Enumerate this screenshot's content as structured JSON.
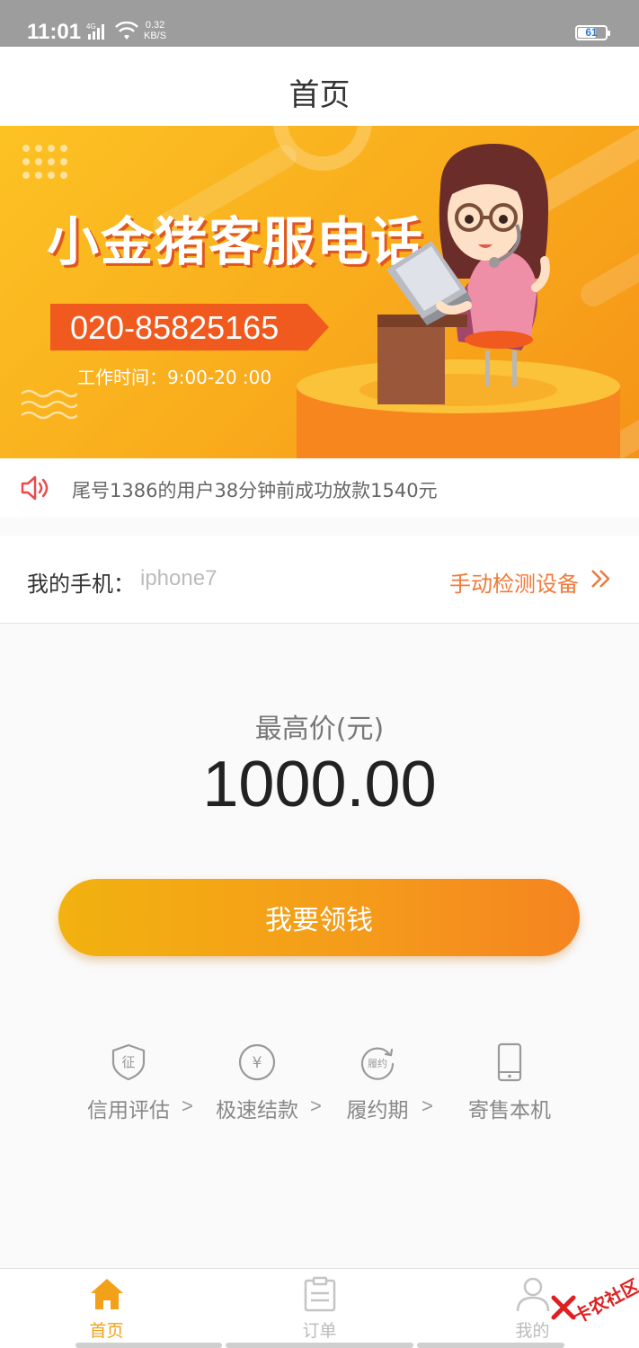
{
  "status_bar": {
    "time": "11:01",
    "network": "4G",
    "speed_value": "0.32",
    "speed_unit": "KB/S",
    "battery": "61"
  },
  "header": {
    "title": "首页"
  },
  "banner": {
    "title": "小金猪客服电话",
    "phone": "020-85825165",
    "hours": "工作时间：9:00-20 :00",
    "colors": {
      "accent": "#f05a1e",
      "background": "#fab01e"
    }
  },
  "notice": {
    "text": "尾号1386的用户38分钟前成功放款1540元"
  },
  "device_row": {
    "label": "我的手机：",
    "model": "iphone7",
    "detect_link": "手动检测设备"
  },
  "price": {
    "label": "最高价(元)",
    "value": "1000.00"
  },
  "cta": {
    "label": "我要领钱"
  },
  "features": [
    {
      "icon": "credit-shield-icon",
      "icon_text": "征",
      "label": "信用评估",
      "arrow": ">"
    },
    {
      "icon": "yuan-circle-icon",
      "icon_text": "¥",
      "label": "极速结款",
      "arrow": ">"
    },
    {
      "icon": "contract-cycle-icon",
      "icon_text": "履约",
      "label": "履约期",
      "arrow": ">"
    },
    {
      "icon": "phone-device-icon",
      "icon_text": "",
      "label": "寄售本机",
      "arrow": ""
    }
  ],
  "bottom_nav": [
    {
      "label": "首页",
      "icon": "home-icon",
      "active": true
    },
    {
      "label": "订单",
      "icon": "clipboard-icon",
      "active": false
    },
    {
      "label": "我的",
      "icon": "user-icon",
      "active": false
    }
  ],
  "watermark": {
    "text": "卡农社区"
  },
  "theme": {
    "orange": "#f2a118",
    "link_orange": "#f07a3a"
  }
}
